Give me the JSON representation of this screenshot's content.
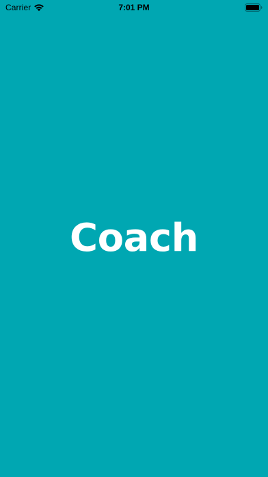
{
  "colors": {
    "background": "#00a7b2",
    "title_text": "#ffffff",
    "status_text": "#000000"
  },
  "status_bar": {
    "carrier": "Carrier",
    "time": "7:01 PM",
    "icons": [
      "wifi-icon",
      "battery-icon"
    ],
    "battery_level": 1.0
  },
  "splash": {
    "title": "Coach"
  }
}
